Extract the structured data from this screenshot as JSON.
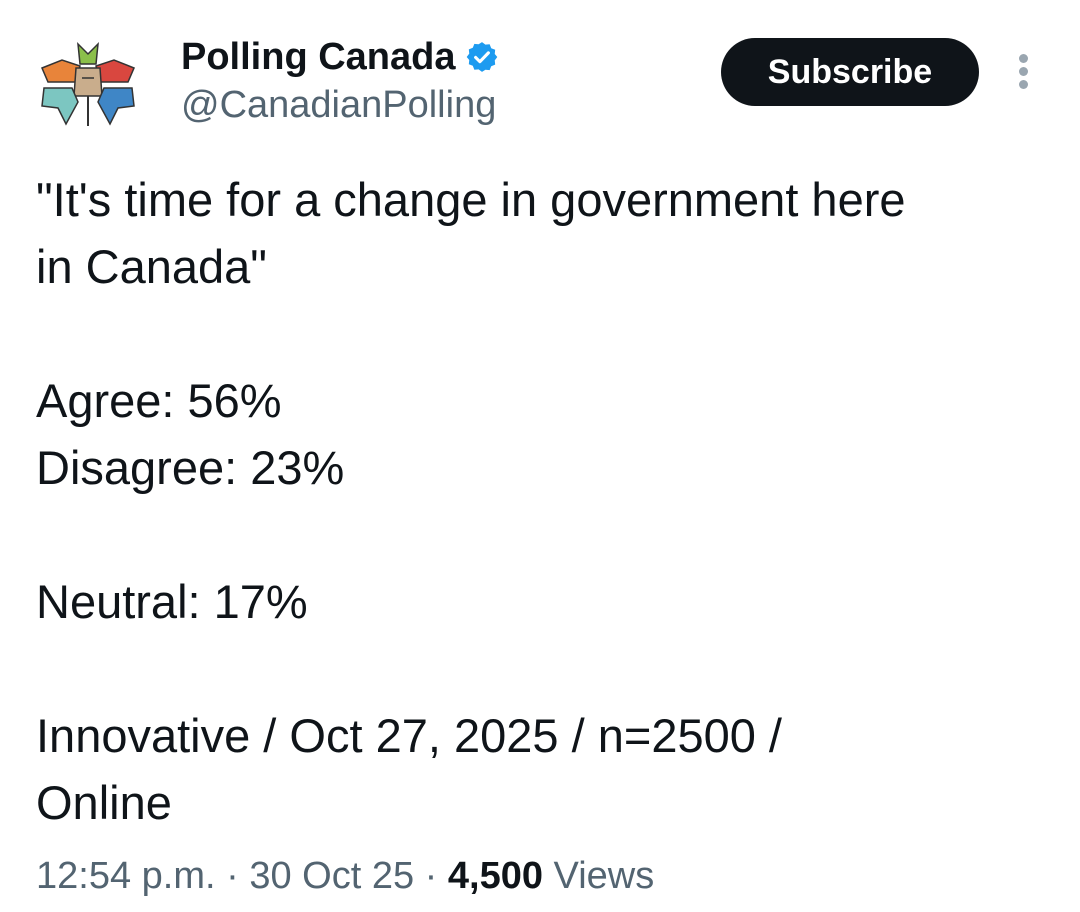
{
  "author": {
    "display_name": "Polling Canada",
    "handle": "@CanadianPolling",
    "verified": true,
    "verified_color": "#1d9bf0"
  },
  "actions": {
    "subscribe_label": "Subscribe",
    "more_icon": "more-vertical-icon"
  },
  "tweet": {
    "quote_line_1": "\"It's time for a change in government here",
    "quote_line_2": "in Canada\"",
    "agree": "Agree: 56%",
    "disagree": "Disagree: 23%",
    "neutral": "Neutral: 17%",
    "source_line_1": "Innovative / Oct 27, 2025 / n=2500 /",
    "source_line_2": "Online"
  },
  "meta": {
    "time": "12:54 p.m.",
    "date": "30 Oct 25",
    "views_count": "4,500",
    "views_label": "Views",
    "separator": "·"
  },
  "colors": {
    "text": "#0f1419",
    "secondary": "#536471",
    "button_bg": "#0f1419",
    "logo_orange": "#e8843a",
    "logo_green": "#8bbf4a",
    "logo_red": "#d9473f",
    "logo_teal": "#7cc6c1",
    "logo_blue": "#3f86c6",
    "logo_tan": "#c9ad8c"
  }
}
